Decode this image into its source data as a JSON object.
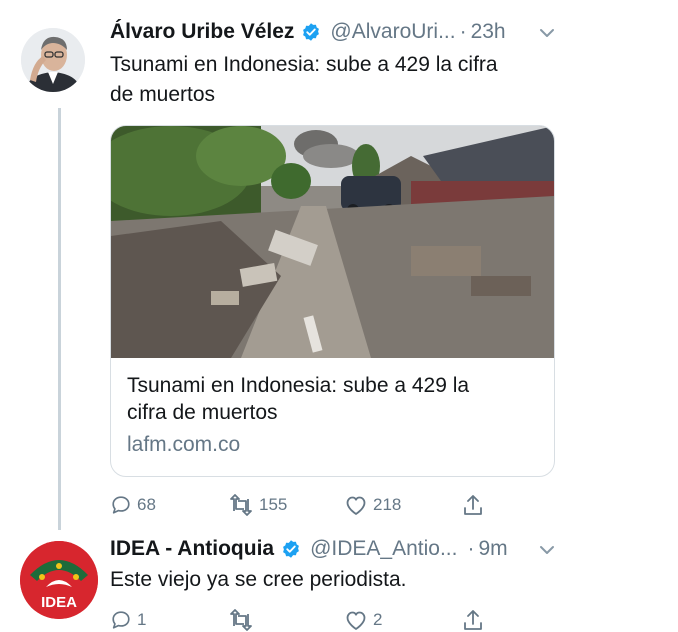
{
  "tweet1": {
    "name": "Álvaro Uribe Vélez",
    "handle": "@AlvaroUri...",
    "separator": "·",
    "time": "23h",
    "text_line1": "Tsunami en Indonesia: sube a 429 la cifra",
    "text_line2": "de muertos",
    "card": {
      "title_line1": "Tsunami en Indonesia: sube a 429 la",
      "title_line2": "cifra de muertos",
      "domain": "lafm.com.co"
    },
    "actions": {
      "replies": "68",
      "retweets": "155",
      "likes": "218"
    }
  },
  "tweet2": {
    "name": "IDEA - Antioquia",
    "handle": "@IDEA_Antio...",
    "separator": "·",
    "time": "9m",
    "text": "Este viejo ya se cree periodista.",
    "avatar_logo_text": "IDEA",
    "actions": {
      "replies": "1",
      "likes": "2"
    }
  },
  "colors": {
    "verified": "#1da1f2",
    "secondary": "#657786",
    "thread_line": "#c9d3da",
    "idea_red": "#d7262e"
  }
}
